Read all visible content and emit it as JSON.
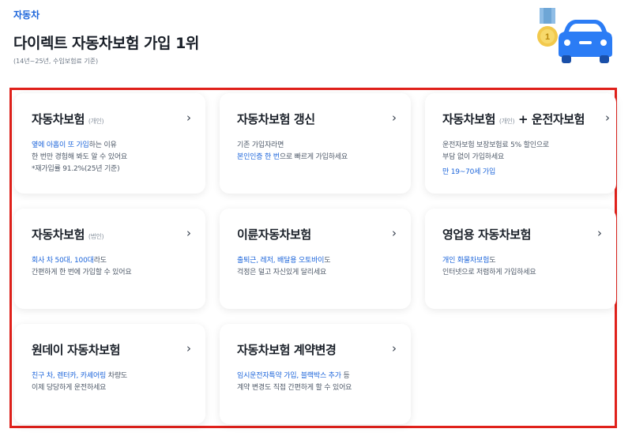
{
  "header": {
    "category": "자동차",
    "title": "다이렉트 자동차보험 가입 1위",
    "note": "(14년~25년, 수입보험료 기준)"
  },
  "hero": {
    "icon": "car-with-medal-icon",
    "medal_text": "1"
  },
  "colors": {
    "accent": "#1b64da",
    "frame": "#e0211b",
    "car": "#2b7cf5"
  },
  "cards": [
    {
      "title": "자동차보험",
      "title_small": "(개인)",
      "title_rest": "",
      "l1_blue": "옆에 아홉이 또 가입",
      "l1_rest": "하는 이유",
      "l2": "한 번만 경험해 봐도 알 수 있어요",
      "l3": "*재가입률 91.2%(25년 기준)"
    },
    {
      "title": "자동차보험 갱신",
      "l1": "기존 가입자라면",
      "l2_blue": "본인인증 한 번",
      "l2_rest": "으로 빠르게 가입하세요"
    },
    {
      "title": "자동차보험",
      "title_small": "(개인)",
      "title_rest": "+ 운전자보험",
      "l1": "운전자보험 보장보험료 5% 할인으로",
      "l2": "부담 없이 가입하세요",
      "l3_blue": "만 19~70세 가입"
    },
    {
      "title": "자동차보험",
      "title_small": "(법인)",
      "l1_blue": "회사 차 50대, 100대",
      "l1_rest": "라도",
      "l2": "간편하게 한 번에 가입할 수 있어요"
    },
    {
      "title": "이륜자동차보험",
      "l1_blue": "출퇴근, 레저, 배달용 오토바이",
      "l1_rest": "도",
      "l2": "걱정은 덜고 자신있게 달리세요"
    },
    {
      "title": "영업용 자동차보험",
      "l1_blue": "개인 화물차보험",
      "l1_rest": "도",
      "l2": "인터넷으로 저렴하게 가입하세요"
    },
    {
      "title": "원데이 자동차보험",
      "l1_blue": "친구 차, 렌터카, 카셰어링",
      "l1_rest": " 차량도",
      "l2": "이제 당당하게 운전하세요"
    },
    {
      "title": "자동차보험 계약변경",
      "l1_blue": "임시운전자특약 가입, 블랙박스 추가",
      "l1_rest": " 등",
      "l2": "계약 변경도 직접 간편하게 할 수 있어요"
    }
  ],
  "chevron": "›"
}
